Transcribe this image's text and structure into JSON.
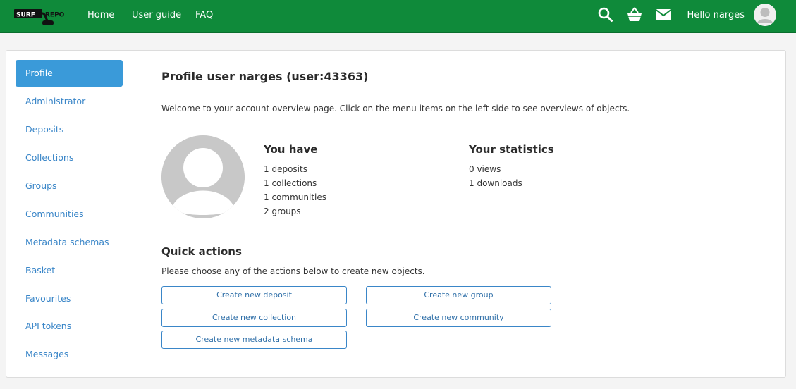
{
  "header": {
    "logo_left": "SURF",
    "logo_right": "REPO",
    "nav": [
      "Home",
      "User guide",
      "FAQ"
    ],
    "icons": [
      "search-icon",
      "basket-icon",
      "mail-icon"
    ],
    "hello_prefix": "Hello",
    "username": "narges"
  },
  "sidebar": {
    "items": [
      {
        "label": "Profile",
        "active": true
      },
      {
        "label": "Administrator"
      },
      {
        "label": "Deposits"
      },
      {
        "label": "Collections"
      },
      {
        "label": "Groups"
      },
      {
        "label": "Communities"
      },
      {
        "label": "Metadata schemas"
      },
      {
        "label": "Basket"
      },
      {
        "label": "Favourites"
      },
      {
        "label": "API tokens"
      },
      {
        "label": "Messages"
      }
    ]
  },
  "main": {
    "title": "Profile user narges (user:43363)",
    "welcome": "Welcome to your account overview page. Click on the menu items on the left side to see overviews of objects.",
    "you_have": {
      "heading": "You have",
      "lines": [
        "1 deposits",
        "1 collections",
        "1 communities",
        "2 groups"
      ]
    },
    "statistics": {
      "heading": "Your statistics",
      "lines": [
        "0 views",
        "1 downloads"
      ]
    },
    "quick_actions": {
      "title": "Quick actions",
      "subtitle": "Please choose any of the actions below to create new objects.",
      "buttons": [
        "Create new deposit",
        "Create new group",
        "Create new collection",
        "Create new community",
        "Create new metadata schema"
      ]
    }
  },
  "colors": {
    "header_green": "#0f8a3a",
    "link_blue": "#3a86c8",
    "active_blue": "#3a9ad9"
  }
}
